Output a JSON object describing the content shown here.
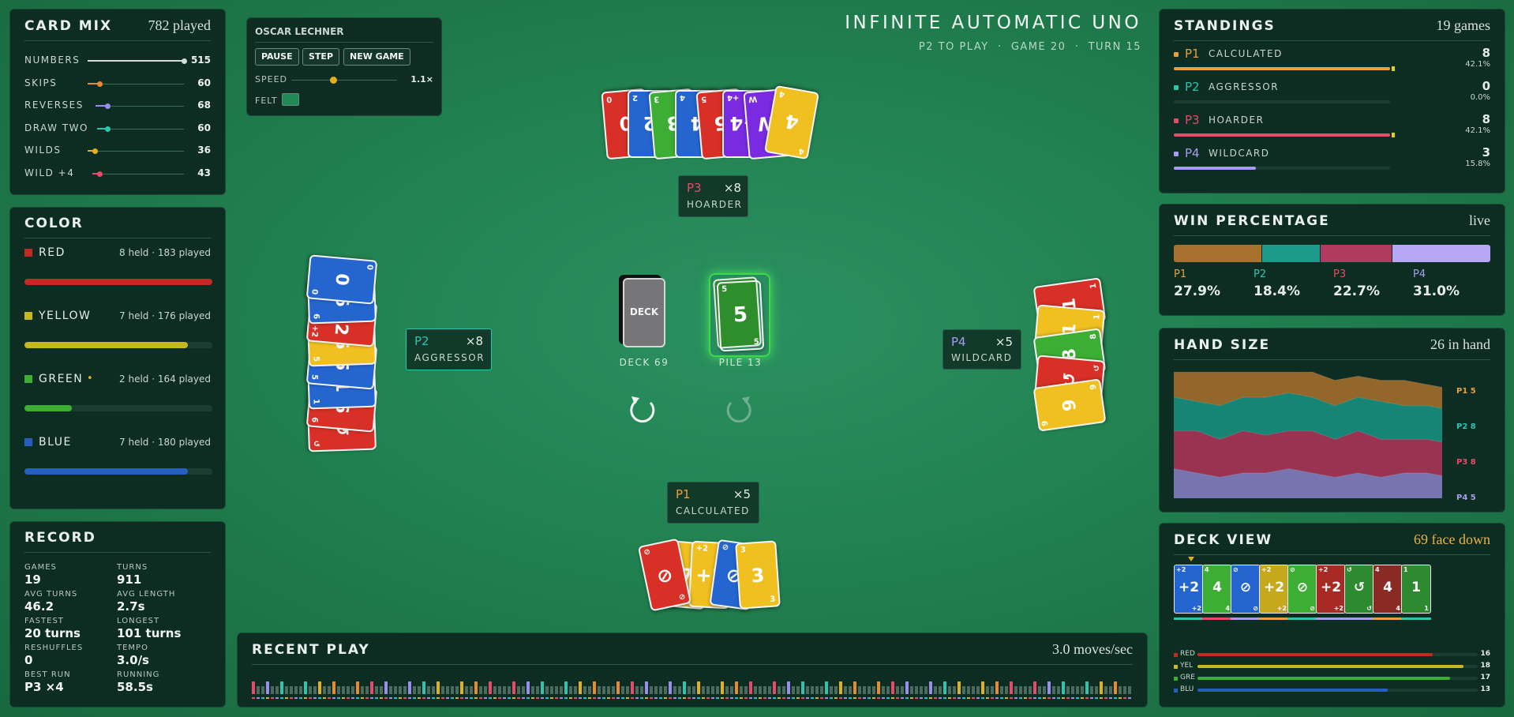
{
  "game": {
    "title": "INFINITE AUTOMATIC UNO",
    "status": "P2 TO PLAY",
    "game": "GAME 20",
    "turn": "TURN 15"
  },
  "card_mix": {
    "title": "CARD MIX",
    "summary": "782 played",
    "rows": [
      {
        "label": "NUMBERS",
        "value": "515",
        "level": 1.0,
        "color": "#d6dcd8"
      },
      {
        "label": "SKIPS",
        "value": "60",
        "level": 0.12,
        "color": "#e88a2e"
      },
      {
        "label": "REVERSES",
        "value": "68",
        "level": 0.13,
        "color": "#9b8cf0"
      },
      {
        "label": "DRAW TWO",
        "value": "60",
        "level": 0.12,
        "color": "#2ec4b0"
      },
      {
        "label": "WILDS",
        "value": "36",
        "level": 0.07,
        "color": "#e0b020"
      },
      {
        "label": "WILD +4",
        "value": "43",
        "level": 0.08,
        "color": "#e84a6a"
      }
    ]
  },
  "controls": {
    "player": "OSCAR LECHNER",
    "pause": "PAUSE",
    "step": "STEP",
    "new_game": "NEW GAME",
    "speed_label": "SPEED",
    "speed_value": "1.1×",
    "speed_level": 0.4,
    "felt_label": "FELT",
    "felt_color": "#1f8a55"
  },
  "color_panel": {
    "title": "COLOR",
    "rows": [
      {
        "name": "RED",
        "stat": "8 held · 183 played",
        "color": "#c42a24",
        "level": 1.0,
        "mark": ""
      },
      {
        "name": "YELLOW",
        "stat": "7 held · 176 played",
        "color": "#c6b820",
        "level": 0.87,
        "mark": ""
      },
      {
        "name": "GREEN",
        "stat": "2 held · 164 played",
        "color": "#3cae34",
        "level": 0.25,
        "mark": "•"
      },
      {
        "name": "BLUE",
        "stat": "7 held · 180 played",
        "color": "#2560c0",
        "level": 0.87,
        "mark": ""
      }
    ]
  },
  "record": {
    "title": "RECORD",
    "items": [
      {
        "k": "GAMES",
        "v": "19"
      },
      {
        "k": "TURNS",
        "v": "911"
      },
      {
        "k": "AVG TURNS",
        "v": "46.2"
      },
      {
        "k": "AVG LENGTH",
        "v": "2.7s"
      },
      {
        "k": "FASTEST",
        "v": "20 turns"
      },
      {
        "k": "LONGEST",
        "v": "101 turns"
      },
      {
        "k": "RESHUFFLES",
        "v": "0"
      },
      {
        "k": "TEMPO",
        "v": "3.0/s"
      },
      {
        "k": "BEST RUN",
        "v": "P3 ×4"
      },
      {
        "k": "RUNNING",
        "v": "58.5s"
      }
    ]
  },
  "players": {
    "p1": {
      "id": "P1",
      "count": "×5",
      "name": "CALCULATED",
      "color": "#e8a040"
    },
    "p2": {
      "id": "P2",
      "count": "×8",
      "name": "AGGRESSOR",
      "color": "#2ec4b0"
    },
    "p3": {
      "id": "P3",
      "count": "×8",
      "name": "HOARDER",
      "color": "#e84a6a"
    },
    "p4": {
      "id": "P4",
      "count": "×5",
      "name": "WILDCARD",
      "color": "#a99cf0"
    }
  },
  "table": {
    "deck_card": "DECK",
    "deck_label": "DECK 69",
    "pile_label": "PILE 13",
    "top_card": {
      "value": "5",
      "color": "#3cae34"
    }
  },
  "hands": {
    "p3": [
      {
        "v": "0",
        "c": "#d83026"
      },
      {
        "v": "2",
        "c": "#2565d0"
      },
      {
        "v": "3",
        "c": "#3cae34"
      },
      {
        "v": "4",
        "c": "#2565d0"
      },
      {
        "v": "5",
        "c": "#d83026"
      },
      {
        "v": "+4",
        "c": "#7a2ae0"
      },
      {
        "v": "W",
        "c": "#7a2ae0"
      },
      {
        "v": "4",
        "c": "#f0c020"
      }
    ],
    "p2": [
      {
        "v": "↺",
        "c": "#d83026"
      },
      {
        "v": "6",
        "c": "#d83026"
      },
      {
        "v": "1",
        "c": "#2565d0"
      },
      {
        "v": "5",
        "c": "#2565d0"
      },
      {
        "v": "5",
        "c": "#f0c020"
      },
      {
        "v": "+2",
        "c": "#d83026"
      },
      {
        "v": "6",
        "c": "#2565d0"
      },
      {
        "v": "0",
        "c": "#2565d0"
      }
    ],
    "p4": [
      {
        "v": "1",
        "c": "#d83026"
      },
      {
        "v": "1",
        "c": "#f0c020"
      },
      {
        "v": "8",
        "c": "#3cae34"
      },
      {
        "v": "↺",
        "c": "#d83026"
      },
      {
        "v": "9",
        "c": "#f0c020"
      }
    ],
    "p1": [
      {
        "v": "⊘",
        "c": "#d83026"
      },
      {
        "v": "7",
        "c": "#f0c020"
      },
      {
        "v": "+2",
        "c": "#f0c020"
      },
      {
        "v": "⊘",
        "c": "#2565d0"
      },
      {
        "v": "3",
        "c": "#f0c020"
      }
    ]
  },
  "recent": {
    "title": "RECENT PLAY",
    "rate": "3.0 moves/sec"
  },
  "standings": {
    "title": "STANDINGS",
    "summary": "19 games",
    "rows": [
      {
        "id": "P1",
        "name": "CALCULATED",
        "wins": "8",
        "pct": "42.1%",
        "color": "#e8a040",
        "level": 0.421
      },
      {
        "id": "P2",
        "name": "AGGRESSOR",
        "wins": "0",
        "pct": "0.0%",
        "color": "#2ec4b0",
        "level": 0
      },
      {
        "id": "P3",
        "name": "HOARDER",
        "wins": "8",
        "pct": "42.1%",
        "color": "#e84a6a",
        "level": 0.421
      },
      {
        "id": "P4",
        "name": "WILDCARD",
        "wins": "3",
        "pct": "15.8%",
        "color": "#a99cf0",
        "level": 0.158
      }
    ]
  },
  "win_pct": {
    "title": "WIN PERCENTAGE",
    "mode": "live",
    "rows": [
      {
        "id": "P1",
        "pct": "27.9%",
        "value": 27.9,
        "color": "#a8722e"
      },
      {
        "id": "P2",
        "pct": "18.4%",
        "value": 18.4,
        "color": "#1e9a8a"
      },
      {
        "id": "P3",
        "pct": "22.7%",
        "value": 22.7,
        "color": "#b03a60"
      },
      {
        "id": "P4",
        "pct": "31.0%",
        "value": 31.0,
        "color": "#b6a8f4"
      }
    ]
  },
  "hand_size": {
    "title": "HAND SIZE",
    "summary": "26 in hand",
    "labels": [
      {
        "text": "P1 5",
        "color": "#e8a040"
      },
      {
        "text": "P2 8",
        "color": "#2ec4b0"
      },
      {
        "text": "P3 8",
        "color": "#e84a6a"
      },
      {
        "text": "P4 5",
        "color": "#a99cf0"
      }
    ]
  },
  "chart_data": {
    "type": "area",
    "title": "HAND SIZE",
    "series": [
      {
        "name": "P1",
        "color": "#9a6a2a",
        "values": [
          7,
          8,
          8,
          7,
          7,
          6,
          6,
          6,
          5,
          5,
          6,
          5,
          5
        ]
      },
      {
        "name": "P2",
        "color": "#178a7a",
        "values": [
          8,
          7,
          8,
          8,
          9,
          9,
          8,
          8,
          8,
          9,
          8,
          8,
          8
        ]
      },
      {
        "name": "P3",
        "color": "#a23454",
        "values": [
          9,
          10,
          9,
          10,
          9,
          9,
          10,
          9,
          10,
          9,
          8,
          8,
          8
        ]
      },
      {
        "name": "P4",
        "color": "#7e78b8",
        "values": [
          7,
          6,
          5,
          6,
          6,
          7,
          6,
          5,
          6,
          5,
          6,
          6,
          5
        ]
      }
    ]
  },
  "deck_view": {
    "title": "DECK VIEW",
    "summary": "69 face down",
    "cards": [
      {
        "v": "+2",
        "c": "#2565d0"
      },
      {
        "v": "4",
        "c": "#3cae34"
      },
      {
        "v": "⊘",
        "c": "#2565d0"
      },
      {
        "v": "+2",
        "c": "#c6a81c"
      },
      {
        "v": "⊘",
        "c": "#3cae34"
      },
      {
        "v": "+2",
        "c": "#a82a24"
      },
      {
        "v": "↺",
        "c": "#2e8a30"
      },
      {
        "v": "4",
        "c": "#8a2a24"
      },
      {
        "v": "1",
        "c": "#2e8a30"
      }
    ],
    "bars": [
      {
        "label": "RED",
        "value": "16",
        "level": 0.84,
        "color": "#c42a24"
      },
      {
        "label": "YEL",
        "value": "18",
        "level": 0.95,
        "color": "#c6b820"
      },
      {
        "label": "GRE",
        "value": "17",
        "level": 0.9,
        "color": "#3cae34"
      },
      {
        "label": "BLU",
        "value": "13",
        "level": 0.68,
        "color": "#2560c0"
      }
    ]
  }
}
